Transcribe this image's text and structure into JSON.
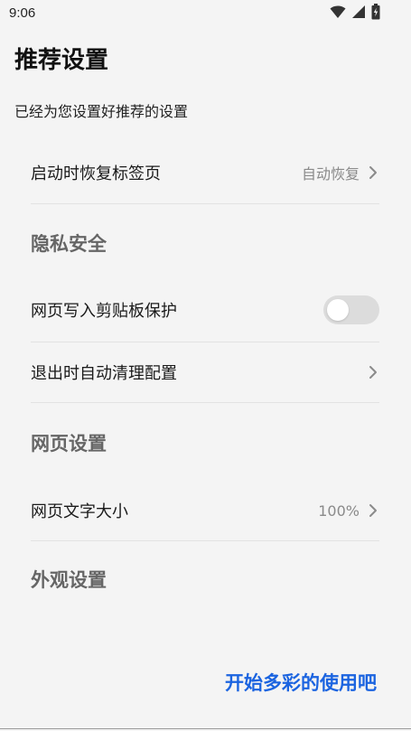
{
  "status_bar": {
    "time": "9:06"
  },
  "header": {
    "title": "推荐设置",
    "subtitle": "已经为您设置好推荐的设置"
  },
  "settings": {
    "restore_tabs": {
      "label": "启动时恢复标签页",
      "value": "自动恢复"
    },
    "privacy_section": "隐私安全",
    "clipboard_protect": {
      "label": "网页写入剪贴板保护",
      "enabled": false
    },
    "auto_clean": {
      "label": "退出时自动清理配置"
    },
    "web_section": "网页设置",
    "text_size": {
      "label": "网页文字大小",
      "value": "100%"
    },
    "appearance_section": "外观设置"
  },
  "footer": {
    "start_label": "开始多彩的使用吧"
  },
  "colors": {
    "accent": "#1b64e0",
    "background": "#f4f4f4",
    "section_header": "#666666",
    "secondary_text": "#8a8a8a"
  }
}
